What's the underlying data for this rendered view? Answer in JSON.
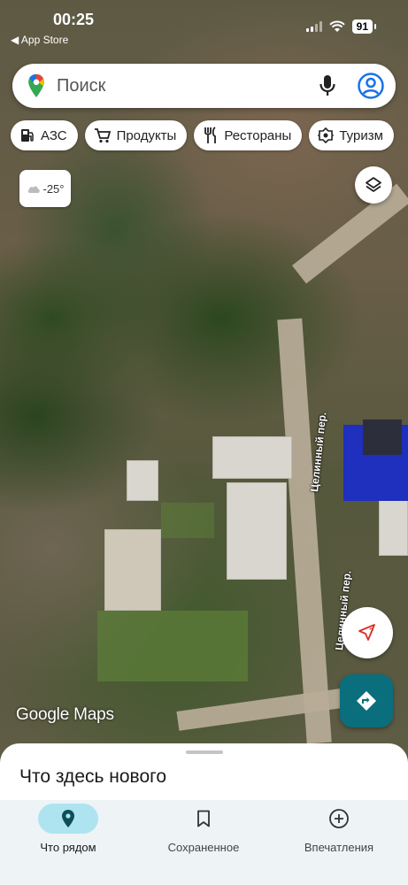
{
  "status_bar": {
    "time": "00:25",
    "back_label": "◀ App Store",
    "battery": "91"
  },
  "search": {
    "placeholder": "Поиск"
  },
  "chips": [
    {
      "label": "АЗС",
      "icon": "gas-station-icon"
    },
    {
      "label": "Продукты",
      "icon": "cart-icon"
    },
    {
      "label": "Рестораны",
      "icon": "restaurant-icon"
    },
    {
      "label": "Туризм",
      "icon": "tourism-icon"
    }
  ],
  "weather": {
    "temperature": "-25°",
    "icon": "cloud-icon"
  },
  "map": {
    "street_label_1": "Целинный пер.",
    "street_label_2": "Целинный пер.",
    "logo": "Google Maps"
  },
  "bottom_sheet": {
    "title": "Что здесь нового"
  },
  "nav": [
    {
      "label": "Что рядом",
      "icon": "location-pin-icon",
      "active": true
    },
    {
      "label": "Сохраненное",
      "icon": "bookmark-icon",
      "active": false
    },
    {
      "label": "Впечатления",
      "icon": "add-circle-icon",
      "active": false
    }
  ],
  "colors": {
    "accent_teal": "#0b6e7d",
    "nav_active_bg": "#aee4f0",
    "nav_bg": "#eef4f6"
  }
}
